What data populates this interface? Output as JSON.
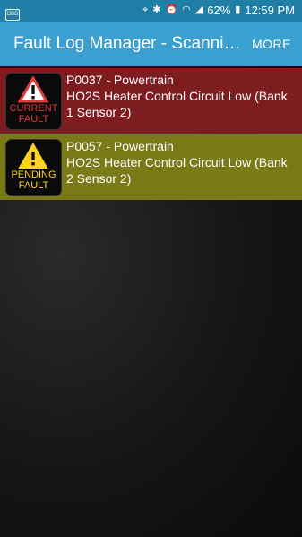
{
  "status_bar": {
    "battery": "62%",
    "time": "12:59 PM",
    "notif_badge": "OBD"
  },
  "app_bar": {
    "title": "Fault Log Manager - Scanning...",
    "more_label": "MORE"
  },
  "faults": [
    {
      "badge_line1": "CURRENT",
      "badge_line2": "FAULT",
      "code_line": "P0037 - Powertrain",
      "description": "HO2S Heater Control Circuit Low (Bank 1 Sensor 2)",
      "color": "#7d1d1f"
    },
    {
      "badge_line1": "PENDING",
      "badge_line2": "FAULT",
      "code_line": "P0057 - Powertrain",
      "description": "HO2S Heater Control Circuit Low (Bank 2 Sensor 2)",
      "color": "#7a7a18"
    }
  ]
}
